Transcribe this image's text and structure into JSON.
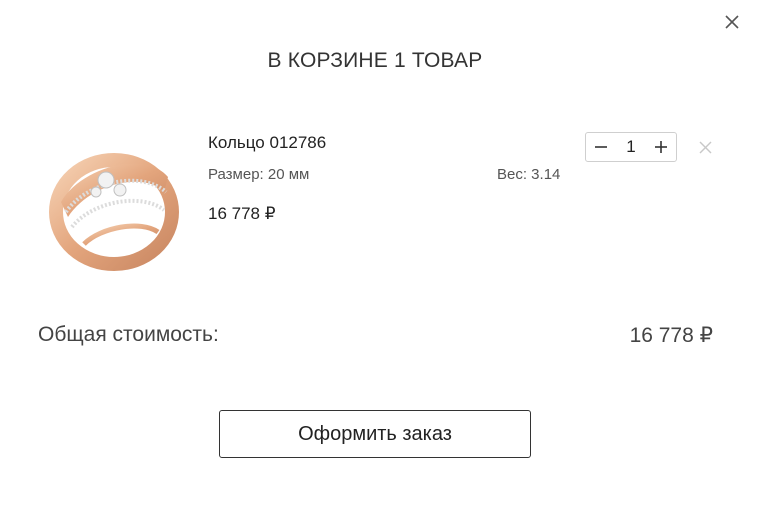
{
  "cart": {
    "title": "В КОРЗИНЕ 1 ТОВАР",
    "close_icon": "close-icon",
    "item": {
      "name": "Кольцо 012786",
      "size": "Размер: 20 мм",
      "weight": "Вес: 3.14",
      "price": "16 778 ₽",
      "quantity": "1",
      "image_icon": "ring-product-image",
      "remove_icon": "remove-item-icon"
    },
    "total_label": "Общая стоимость:",
    "total_value": "16 778 ₽",
    "checkout_label": "Оформить заказ"
  },
  "colors": {
    "gold": "#e9b48e",
    "border": "#cfcfcf",
    "text": "#222222",
    "muted": "#555555"
  }
}
